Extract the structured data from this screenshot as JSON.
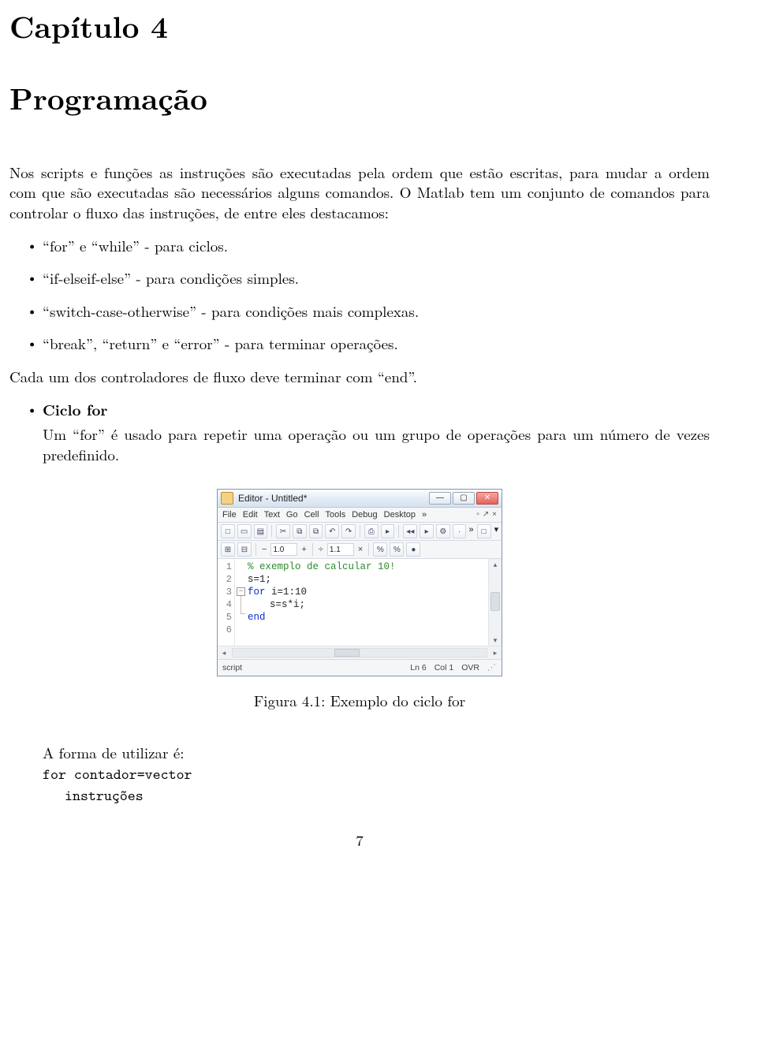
{
  "chapter": {
    "label": "Capítulo 4",
    "title": "Programação"
  },
  "intro": "Nos scripts e funções as instruções são executadas pela ordem que estão escritas, para mudar a ordem com que são executadas são necessários alguns comandos. O Matlab tem um conjunto de comandos para controlar o fluxo das instruções, de entre eles destacamos:",
  "bullets1": [
    "“for” e “while” - para ciclos.",
    "“if-elseif-else” - para condições simples.",
    "“switch-case-otherwise” - para condições mais complexas.",
    "“break”, “return” e “error” - para terminar operações."
  ],
  "mid": "Cada um dos controladores de fluxo deve terminar com “end”.",
  "ciclo": {
    "heading": "Ciclo for",
    "text": "Um “for” é usado para repetir uma operação ou um grupo de operações para um número de vezes predefinido."
  },
  "editor": {
    "title": "Editor - Untitled*",
    "menus": [
      "File",
      "Edit",
      "Text",
      "Go",
      "Cell",
      "Tools",
      "Debug",
      "Desktop"
    ],
    "menus_overflow": "»",
    "dock_icons": [
      "▫",
      "↗",
      "×"
    ],
    "toolbar1_icons": [
      "□",
      "▭",
      "▤",
      "✂",
      "⧉",
      "⧉",
      "↶",
      "↷",
      "⎙",
      "▸",
      "◂◂",
      "▸",
      "⚙",
      "·"
    ],
    "toolbar1_overflow": "»",
    "toolbar1_right": [
      "□",
      "▾"
    ],
    "toolbar2": {
      "cellA": "⊞",
      "cellB": "⊟",
      "minus": "−",
      "field1": "1.0",
      "plus": "+",
      "div": "÷",
      "field2": "1.1",
      "times": "×",
      "pct1": "%",
      "pct2": "%",
      "dot": "●"
    },
    "gutter": [
      "1",
      "2",
      "3",
      "4",
      "5",
      "6"
    ],
    "code": {
      "l1": "% exemplo de calcular 10!",
      "l2": "s=1;",
      "l3a": "for ",
      "l3b": "i=1:10",
      "l4": "s=s*i;",
      "l5": "end"
    },
    "status": {
      "left": "script",
      "ln": "Ln 6",
      "col": "Col 1",
      "ovr": "OVR"
    }
  },
  "fig_caption": "Figura 4.1:  Exemplo do ciclo for",
  "usage": {
    "lead": "A forma de utilizar é:",
    "line1": "for contador=vector",
    "line2": "instruções"
  },
  "page_number": "7"
}
